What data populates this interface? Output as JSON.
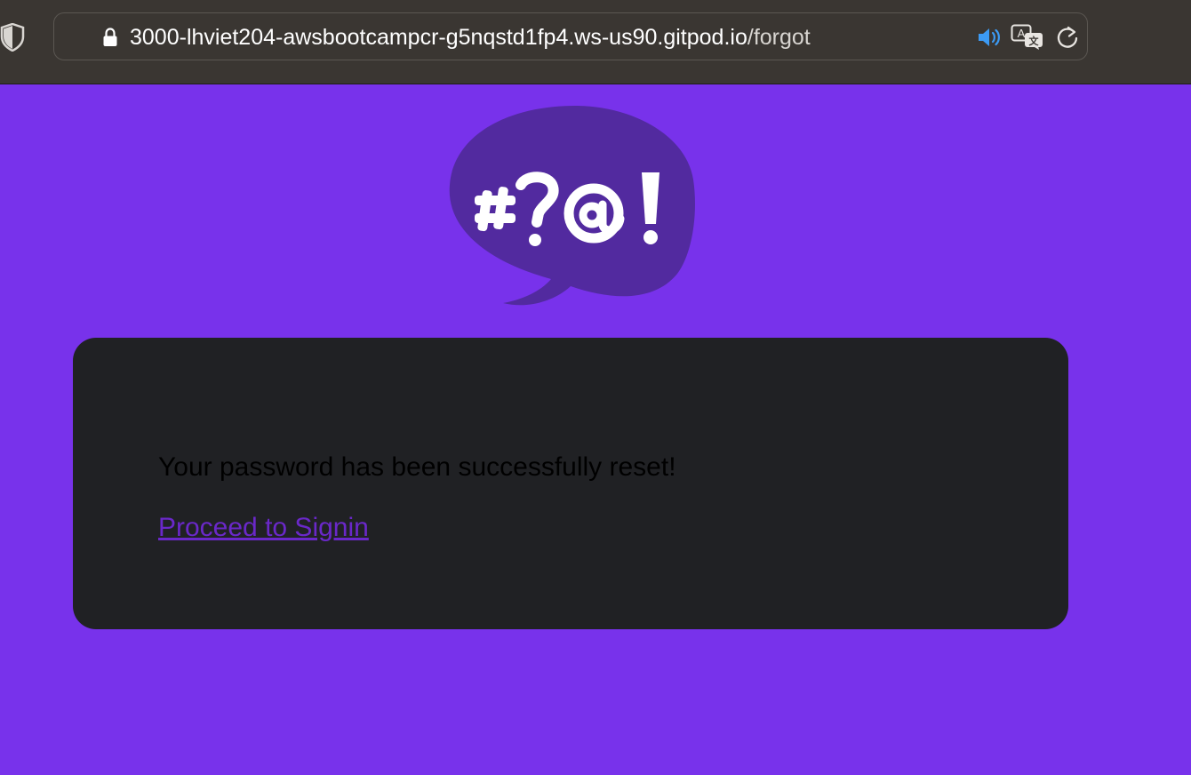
{
  "browser": {
    "url_host": "3000-lhviet204-awsbootcampcr-g5nqstd1fp4.ws-us90.gitpod.io",
    "url_path": "/forgot",
    "icons": [
      "shield-icon",
      "lock-icon",
      "speaker-icon",
      "translate-icon",
      "reload-icon"
    ]
  },
  "logo": {
    "text": "#?@!",
    "bubble_color": "#522A9F"
  },
  "card": {
    "message": "Your password has been successfully reset!",
    "link_label": "Proceed to Signin"
  },
  "colors": {
    "page_background": "#7832EB",
    "card_background": "#202124",
    "link": "#6A28C9",
    "speaker_accent": "#3C9BF5"
  }
}
